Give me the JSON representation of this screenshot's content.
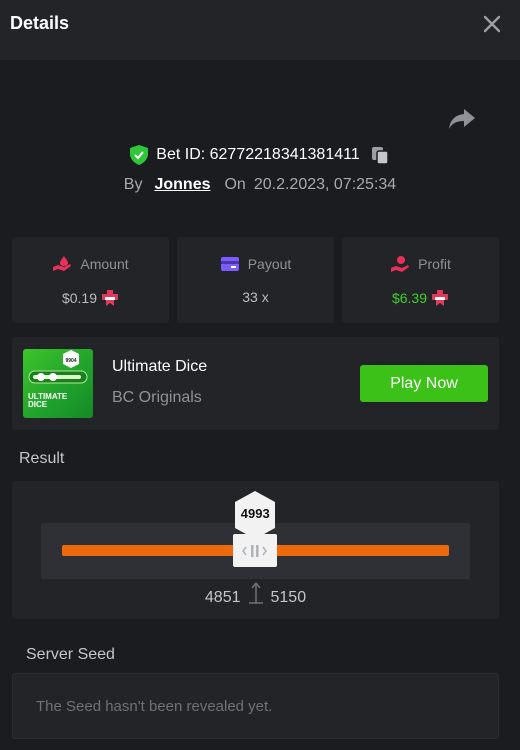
{
  "header": {
    "title": "Details"
  },
  "bet": {
    "id_label": "Bet ID: 62772218341381411",
    "by_label": "By",
    "user": "Jonnes",
    "on_label": "On",
    "datetime": "20.2.2023, 07:25:34"
  },
  "stats": [
    {
      "label": "Amount",
      "value": "$0.19",
      "icon": "hand-drop-icon",
      "coin": "coin-icon"
    },
    {
      "label": "Payout",
      "value": "33 x",
      "icon": "card-icon"
    },
    {
      "label": "Profit",
      "value": "$6.39",
      "icon": "hand-coin-icon",
      "coin": "coin-icon"
    }
  ],
  "game": {
    "thumb_title": "ULTIMATE DICE",
    "thumb_badge": "9904",
    "name": "Ultimate Dice",
    "provider": "BC Originals",
    "play_label": "Play Now"
  },
  "result": {
    "label": "Result",
    "value": "4993",
    "range_low": "4851",
    "range_high": "5150",
    "marker_position": 0.4993
  },
  "seed": {
    "label": "Server Seed",
    "message": "The Seed hasn't been revealed yet."
  },
  "colors": {
    "background": "#1b1c1f",
    "panel": "#232428",
    "accent_green": "#3bc117",
    "profit_green": "#3fd12b",
    "bar_orange": "#ed6a0c",
    "shield_green": "#2fc63a",
    "icon_red": "#e9305a",
    "icon_purple": "#7d5cff"
  }
}
